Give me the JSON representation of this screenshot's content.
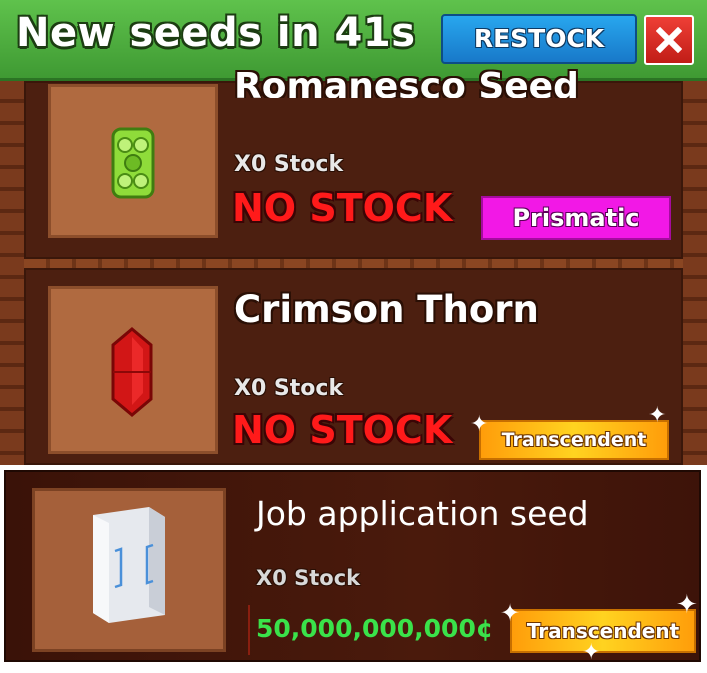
{
  "header": {
    "title": "New seeds in 41s",
    "restock_label": "RESTOCK",
    "close_label": "X"
  },
  "items": [
    {
      "name": "Romanesco Seed",
      "stock": "X0 Stock",
      "status": "NO STOCK",
      "rarity": "Prismatic",
      "icon": "romanesco-seed-icon"
    },
    {
      "name": "Crimson Thorn",
      "stock": "X0 Stock",
      "status": "NO STOCK",
      "rarity": "Transcendent",
      "icon": "crimson-thorn-seed-icon"
    },
    {
      "name": "Job application seed",
      "stock": "X0 Stock",
      "price": "50,000,000,000¢",
      "rarity": "Transcendent",
      "icon": "job-application-seed-icon"
    }
  ],
  "colors": {
    "header_green": "#4cae3f",
    "restock_blue": "#1f8fe0",
    "close_red": "#e0302a",
    "panel_brown": "#6a3018",
    "no_stock_red": "#ff1a1a",
    "prismatic_pink": "#f218e6",
    "transcendent_gold": "#ffc21a",
    "price_green": "#3ae24a"
  }
}
